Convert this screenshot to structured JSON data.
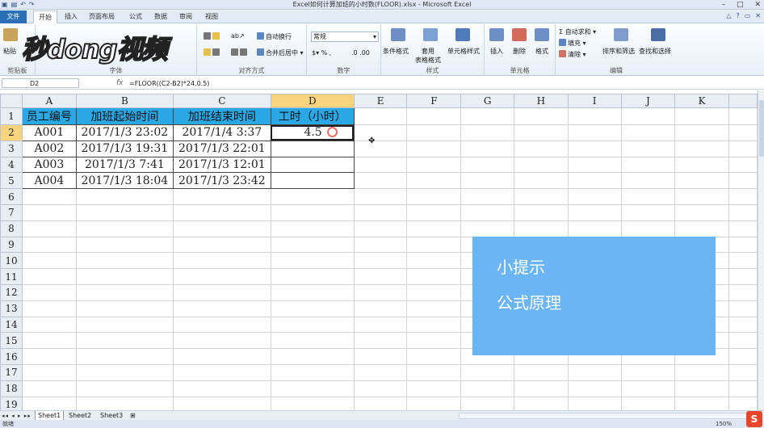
{
  "window": {
    "title": "Excel如何计算加班的小时数(FLOOR).xlsx - Microsoft Excel"
  },
  "ribbon_tabs": {
    "file": "文件",
    "tabs": [
      "开始",
      "插入",
      "页面布局",
      "公式",
      "数据",
      "审阅",
      "视图"
    ]
  },
  "ribbon": {
    "clipboard": {
      "name": "剪贴板",
      "paste": "粘贴"
    },
    "font": {
      "name": "字体"
    },
    "alignment": {
      "name": "对齐方式",
      "wrap": "自动换行",
      "merge": "合并后居中"
    },
    "number": {
      "name": "数字",
      "format": "常规"
    },
    "styles": {
      "name": "样式",
      "cond": "条件格式",
      "table": "套用\n表格格式",
      "cell": "单元格样式"
    },
    "cells": {
      "name": "单元格",
      "insert": "插入",
      "delete": "删除",
      "format": "格式"
    },
    "editing": {
      "name": "编辑",
      "autosum": "自动求和",
      "fill": "填充",
      "clear": "清除",
      "sort": "排序和筛选",
      "find": "查找和选择"
    }
  },
  "watermark": {
    "text": "秒dong视频"
  },
  "formula_bar": {
    "name_box": "D2",
    "fx": "fx",
    "formula": "=FLOOR((C2-B2)*24,0.5)"
  },
  "columns": [
    "A",
    "B",
    "C",
    "D",
    "E",
    "F",
    "G",
    "H",
    "I",
    "J",
    "K"
  ],
  "rows": [
    "1",
    "2",
    "3",
    "4",
    "5",
    "6",
    "7",
    "8",
    "9",
    "10",
    "11",
    "12",
    "13",
    "14",
    "15",
    "16",
    "17",
    "18",
    "19"
  ],
  "table": {
    "headers": [
      "员工编号",
      "加班起始时间",
      "加班结束时间",
      "工时（小时）"
    ],
    "data": [
      [
        "A001",
        "2017/1/3 23:02",
        "2017/1/4 3:37",
        "4.5"
      ],
      [
        "A002",
        "2017/1/3 19:31",
        "2017/1/3 22:01",
        ""
      ],
      [
        "A003",
        "2017/1/3 7:41",
        "2017/1/3 12:01",
        ""
      ],
      [
        "A004",
        "2017/1/3 18:04",
        "2017/1/3 23:42",
        ""
      ]
    ]
  },
  "tip": {
    "line1": "小提示",
    "line2": "公式原理"
  },
  "sheets": [
    "Sheet1",
    "Sheet2",
    "Sheet3"
  ],
  "status": {
    "ready": "就绪",
    "zoom": "150%"
  }
}
